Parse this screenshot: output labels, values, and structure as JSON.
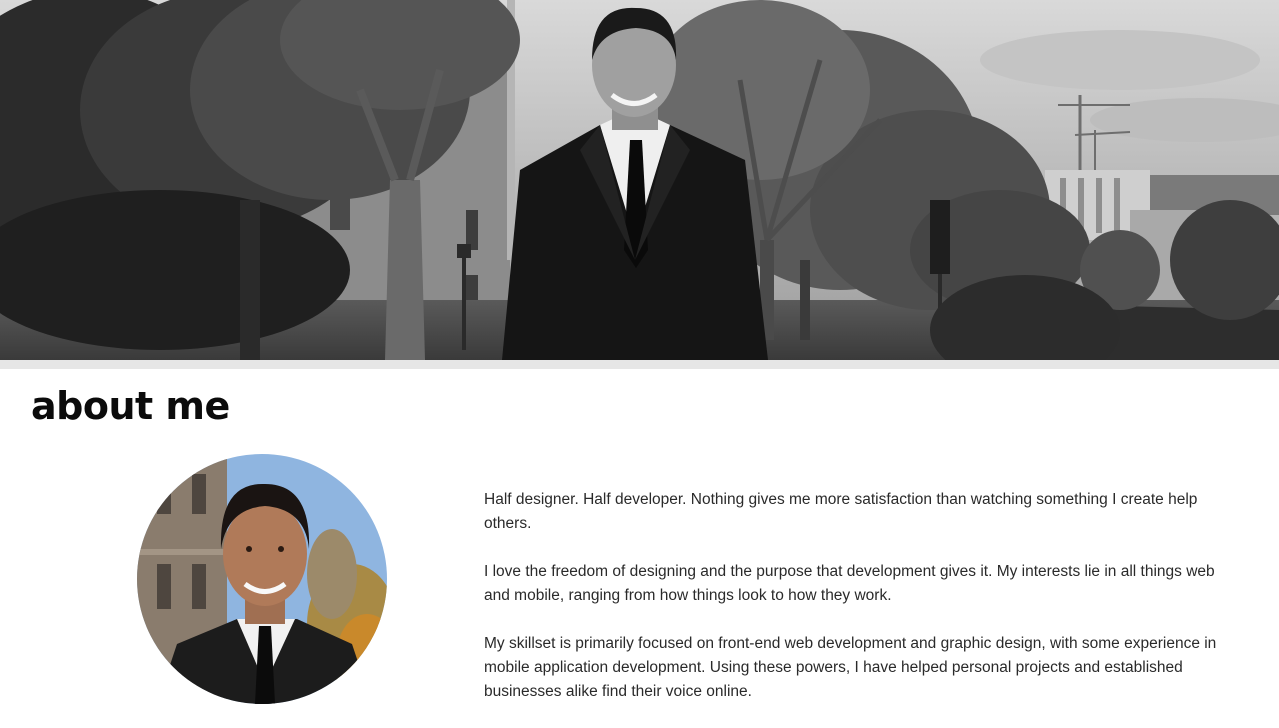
{
  "hero": {
    "image": "black-and-white photo of man in suit standing on campus walkway with trees and buildings"
  },
  "about": {
    "title": "about me",
    "portrait": "circular color headshot of smiling man in suit",
    "paragraphs": [
      "Half designer. Half developer. Nothing gives me more satisfaction than watching something I create help others.",
      "I love the freedom of designing and the purpose that development gives it. My interests lie in all things web and mobile, ranging from how things look to how they work.",
      "My skillset is primarily focused on front-end web development and graphic design, with some experience in mobile application development. Using these powers, I have helped personal projects and established businesses alike find their voice online."
    ]
  },
  "colors": {
    "title": "#0b0b0b",
    "body_text": "#2a2a2a",
    "divider": "#e6e6e6",
    "background": "#ffffff"
  }
}
